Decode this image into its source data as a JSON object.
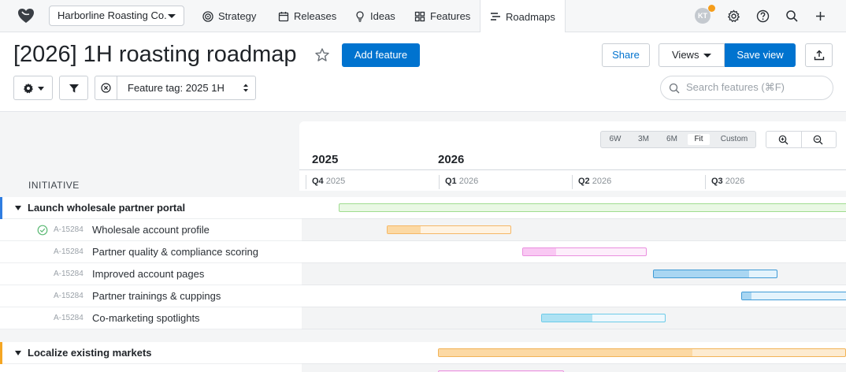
{
  "nav": {
    "workspace": "Harborline Roasting Co.",
    "tabs": [
      {
        "label": "Strategy",
        "icon": "target-icon"
      },
      {
        "label": "Releases",
        "icon": "calendar-icon"
      },
      {
        "label": "Ideas",
        "icon": "lightbulb-icon"
      },
      {
        "label": "Features",
        "icon": "grid-icon"
      },
      {
        "label": "Roadmaps",
        "icon": "roadmap-icon",
        "active": true
      }
    ],
    "avatar_initials": "KT"
  },
  "header": {
    "title": "[2026] 1H roasting roadmap",
    "add_feature": "Add feature",
    "share": "Share",
    "views": "Views",
    "save_view": "Save view",
    "filter_label": "Feature tag: 2025 1H",
    "search_placeholder": "Search features (⌘F)"
  },
  "timeline": {
    "zoom_options": [
      "6W",
      "3M",
      "6M",
      "Fit",
      "Custom"
    ],
    "zoom_selected": "Fit",
    "years": [
      "2025",
      "2026"
    ],
    "quarters": [
      {
        "q": "Q4",
        "year": "2025"
      },
      {
        "q": "Q1",
        "year": "2026"
      },
      {
        "q": "Q2",
        "year": "2026"
      },
      {
        "q": "Q3",
        "year": "2026"
      }
    ]
  },
  "column_header": "INITIATIVE",
  "initiatives": [
    {
      "name": "Launch wholesale partner portal",
      "accent": "#2f7de1",
      "features": [
        {
          "code": "A-15284",
          "name": "Wholesale account profile",
          "done": true
        },
        {
          "code": "A-15284",
          "name": "Partner quality & compliance scoring"
        },
        {
          "code": "A-15284",
          "name": "Improved account pages"
        },
        {
          "code": "A-15284",
          "name": "Partner trainings & cuppings"
        },
        {
          "code": "A-15284",
          "name": "Co-marketing spotlights"
        }
      ]
    },
    {
      "name": "Localize existing markets",
      "accent": "#f5a623"
    }
  ],
  "colors": {
    "primary": "#0073cf",
    "green_bar": "#e9f8e4",
    "orange_bar": "#fcd9a4",
    "pink_bar": "#f9c8f3",
    "blue_bar": "#a9d6f2"
  }
}
